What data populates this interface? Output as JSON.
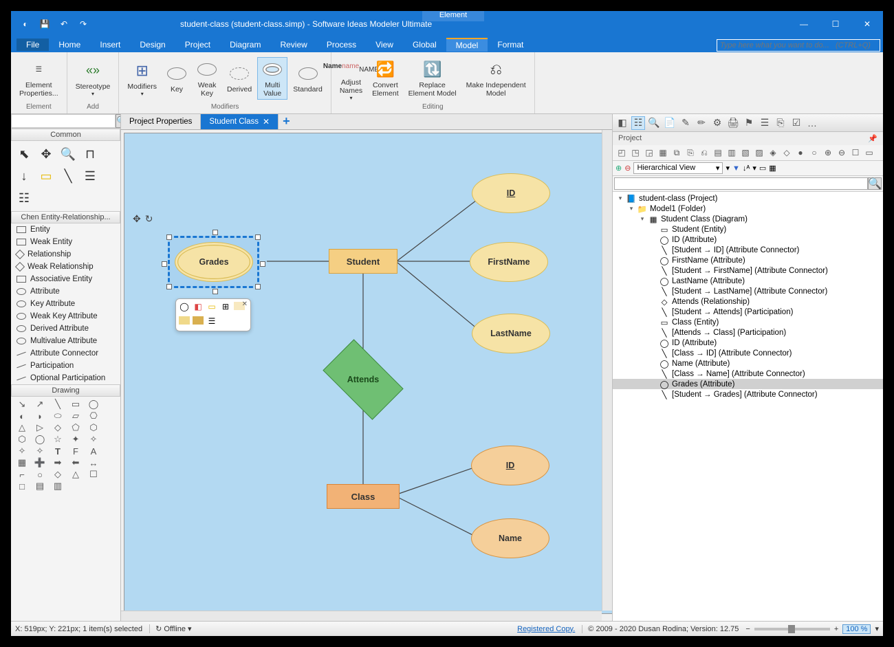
{
  "titlebar": {
    "doc": "student-class (student-class.simp)",
    "app": " - Software Ideas Modeler Ultimate",
    "context_tab": "Element"
  },
  "menu": {
    "items": [
      "File",
      "Home",
      "Insert",
      "Design",
      "Project",
      "Diagram",
      "Review",
      "Process",
      "View",
      "Global",
      "Model",
      "Format"
    ],
    "active": "Model",
    "search_ph": "Type here what you want to do...   (CTRL+Q)"
  },
  "ribbon": {
    "groups": [
      {
        "label": "Element",
        "items": [
          {
            "t": "Element\nProperties..."
          }
        ]
      },
      {
        "label": "Add",
        "items": [
          {
            "t": "Stereotype"
          }
        ]
      },
      {
        "label": "Modifiers",
        "items": [
          {
            "t": "Modifiers"
          },
          {
            "t": "Key"
          },
          {
            "t": "Weak\nKey"
          },
          {
            "t": "Derived"
          },
          {
            "t": "Multi\nValue",
            "sel": true
          },
          {
            "t": "Standard"
          }
        ]
      },
      {
        "label": "Editing",
        "items": [
          {
            "t": "Adjust\nNames"
          },
          {
            "t": "Convert\nElement"
          },
          {
            "t": "Replace\nElement Model"
          },
          {
            "t": "Make Independent\nModel"
          }
        ]
      }
    ]
  },
  "sidebar": {
    "cat_common": "Common",
    "cat_chen": "Chen Entity-Relationship...",
    "cat_draw": "Drawing",
    "chen_items": [
      "Entity",
      "Weak Entity",
      "Relationship",
      "Weak Relationship",
      "Associative Entity",
      "Attribute",
      "Key Attribute",
      "Weak Key Attribute",
      "Derived Attribute",
      "Multivalue Attribute",
      "Attribute Connector",
      "Participation",
      "Optional Participation"
    ]
  },
  "tabs": {
    "t1": "Project Properties",
    "t2": "Student Class"
  },
  "diagram": {
    "student": "Student",
    "class": "Class",
    "attends": "Attends",
    "grades": "Grades",
    "id": "ID",
    "firstname": "FirstName",
    "lastname": "LastName",
    "id2": "ID",
    "name": "Name"
  },
  "project_panel": {
    "title": "Project",
    "view": "Hierarchical View",
    "tree": [
      {
        "d": 0,
        "exp": "▾",
        "ic": "📘",
        "t": "student-class (Project)"
      },
      {
        "d": 1,
        "exp": "▾",
        "ic": "📁",
        "t": "Model1 (Folder)"
      },
      {
        "d": 2,
        "exp": "▾",
        "ic": "▦",
        "t": "Student Class (Diagram)"
      },
      {
        "d": 3,
        "ic": "▭",
        "t": "Student (Entity)"
      },
      {
        "d": 3,
        "ic": "◯",
        "t": "ID (Attribute)"
      },
      {
        "d": 3,
        "ic": "╲",
        "t": "[Student → ID] (Attribute Connector)"
      },
      {
        "d": 3,
        "ic": "◯",
        "t": "FirstName (Attribute)"
      },
      {
        "d": 3,
        "ic": "╲",
        "t": "[Student → FirstName] (Attribute Connector)"
      },
      {
        "d": 3,
        "ic": "◯",
        "t": "LastName (Attribute)"
      },
      {
        "d": 3,
        "ic": "╲",
        "t": "[Student → LastName] (Attribute Connector)"
      },
      {
        "d": 3,
        "ic": "◇",
        "t": "Attends (Relationship)"
      },
      {
        "d": 3,
        "ic": "╲",
        "t": "[Student → Attends] (Participation)"
      },
      {
        "d": 3,
        "ic": "▭",
        "t": "Class (Entity)"
      },
      {
        "d": 3,
        "ic": "╲",
        "t": "[Attends → Class] (Participation)"
      },
      {
        "d": 3,
        "ic": "◯",
        "t": "ID (Attribute)"
      },
      {
        "d": 3,
        "ic": "╲",
        "t": "[Class → ID] (Attribute Connector)"
      },
      {
        "d": 3,
        "ic": "◯",
        "t": "Name (Attribute)"
      },
      {
        "d": 3,
        "ic": "╲",
        "t": "[Class → Name] (Attribute Connector)"
      },
      {
        "d": 3,
        "ic": "◯",
        "t": "Grades (Attribute)",
        "sel": true
      },
      {
        "d": 3,
        "ic": "╲",
        "t": "[Student → Grades] (Attribute Connector)"
      }
    ]
  },
  "status": {
    "pos": "X: 519px; Y: 221px; 1 item(s) selected",
    "offline": "Offline",
    "reg": "Registered Copy.",
    "copy": "© 2009 - 2020 Dusan Rodina; Version: 12.75",
    "zoom": "100 %"
  }
}
